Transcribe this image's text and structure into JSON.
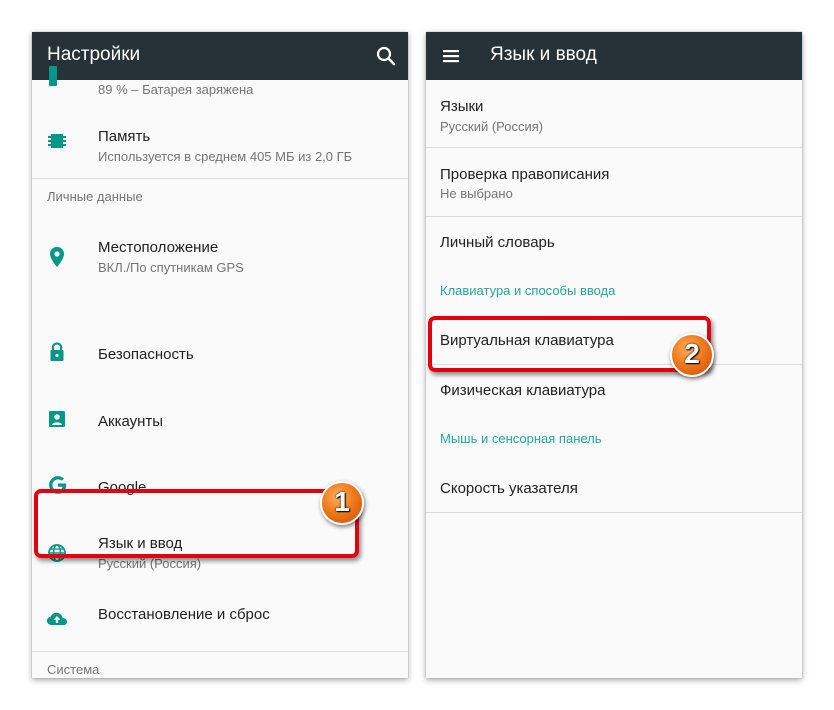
{
  "left_screen": {
    "appbar": {
      "title": "Настройки",
      "search_icon": "search-icon"
    },
    "battery_row": {
      "subtitle": "89 % – Батарея заряжена"
    },
    "memory_row": {
      "title": "Память",
      "subtitle": "Используется в среднем 405 МБ из 2,0 ГБ"
    },
    "section_personal": "Личные данные",
    "location_row": {
      "title": "Местоположение",
      "subtitle": "ВКЛ./По спутникам GPS"
    },
    "security_row": {
      "title": "Безопасность"
    },
    "accounts_row": {
      "title": "Аккаунты"
    },
    "google_row": {
      "title": "Google"
    },
    "language_row": {
      "title": "Язык и ввод",
      "subtitle": "Русский (Россия)"
    },
    "backup_row": {
      "title": "Восстановление и сброс"
    },
    "section_system": "Система",
    "badge": "1"
  },
  "right_screen": {
    "appbar": {
      "title": "Язык и ввод",
      "menu_icon": "menu-icon"
    },
    "languages_row": {
      "title": "Языки",
      "subtitle": "Русский (Россия)"
    },
    "spellcheck_row": {
      "title": "Проверка правописания",
      "subtitle": "Не выбрано"
    },
    "dictionary_row": {
      "title": "Личный словарь"
    },
    "section_keyboard": "Клавиатура и способы ввода",
    "virtual_keyboard_row": {
      "title": "Виртуальная клавиатура"
    },
    "physical_keyboard_row": {
      "title": "Физическая клавиатура"
    },
    "section_mouse": "Мышь и сенсорная панель",
    "pointer_speed_row": {
      "title": "Скорость указателя"
    },
    "badge": "2"
  },
  "colors": {
    "appbar": "#263238",
    "accent_teal": "#26a69a",
    "icon_teal": "#009688",
    "highlight_red": "#e3000f",
    "badge_orange": "#f07a1a"
  }
}
